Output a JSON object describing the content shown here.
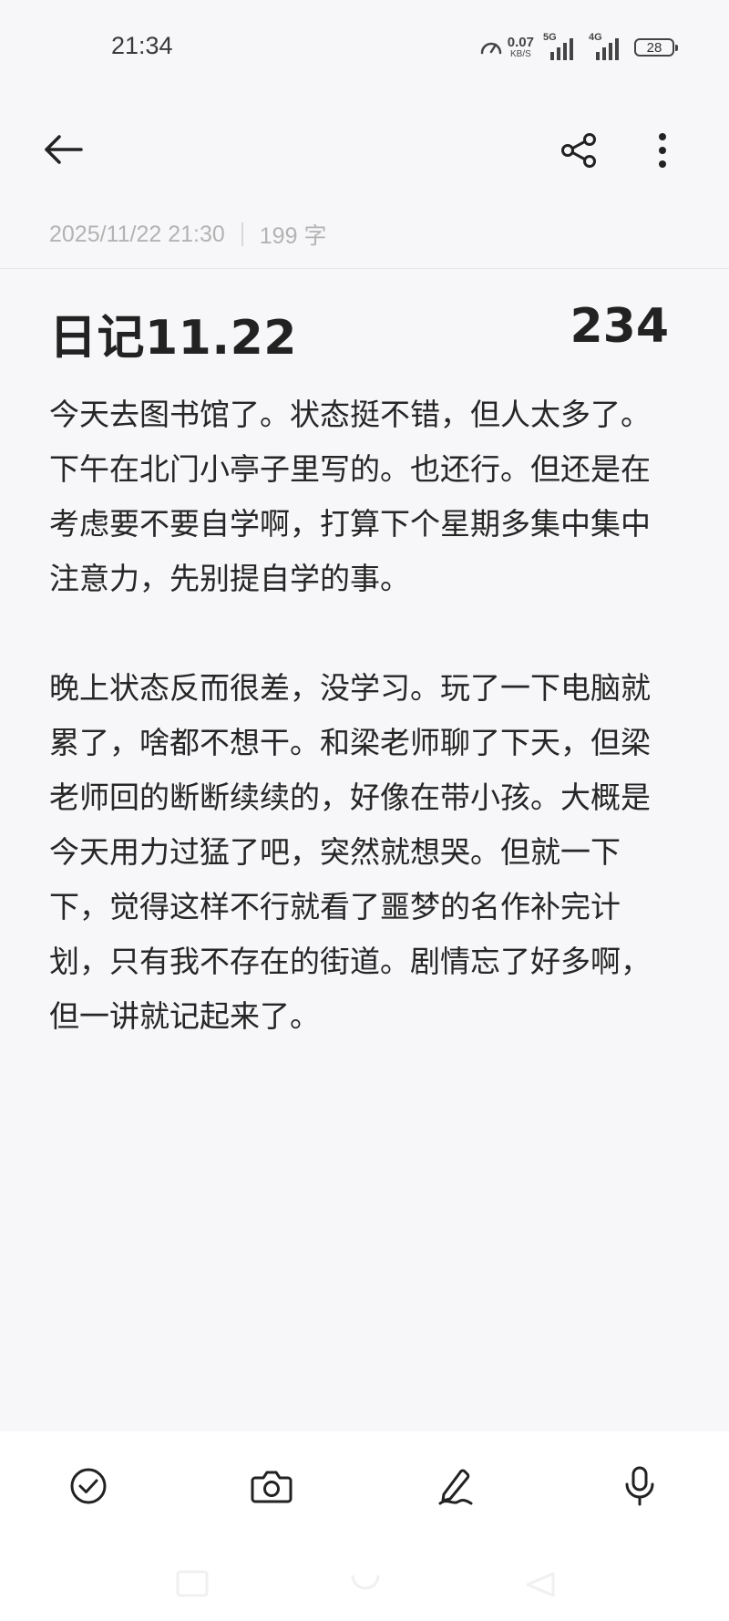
{
  "status_bar": {
    "time": "21:34",
    "net_speed_value": "0.07",
    "net_speed_unit": "KB/S",
    "signal_1_label": "5G",
    "signal_2_label": "4G",
    "battery_level": "28"
  },
  "toolbar": {
    "back_icon": "arrow-left-icon",
    "share_icon": "share-icon",
    "more_icon": "more-vertical-icon"
  },
  "note": {
    "timestamp": "2025/11/22 21:30",
    "word_count": "199 字",
    "title": "日记11.22",
    "title_count": "234",
    "paragraphs": [
      "今天去图书馆了。状态挺不错，但人太多了。下午在北门小亭子里写的。也还行。但还是在考虑要不要自学啊，打算下个星期多集中集中注意力，先别提自学的事。",
      "晚上状态反而很差，没学习。玩了一下电脑就累了，啥都不想干。和梁老师聊了下天，但梁老师回的断断续续的，好像在带小孩。大概是今天用力过猛了吧，突然就想哭。但就一下下，觉得这样不行就看了噩梦的名作补完计划，只有我不存在的街道。剧情忘了好多啊，但一讲就记起来了。"
    ]
  },
  "bottom_tools": {
    "items": [
      {
        "icon": "check-circle-icon"
      },
      {
        "icon": "camera-icon"
      },
      {
        "icon": "pen-icon"
      },
      {
        "icon": "microphone-icon"
      }
    ]
  },
  "colors": {
    "background": "#f7f7f9",
    "text": "#222222",
    "meta_text": "#b3b3b3",
    "bottom_bar": "#ffffff"
  }
}
